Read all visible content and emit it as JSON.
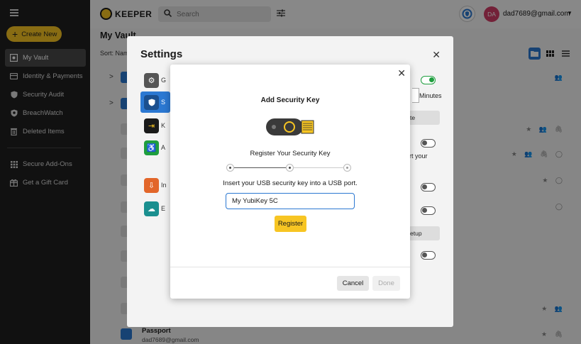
{
  "sidebar": {
    "create_label": "Create New",
    "items": [
      {
        "label": "My Vault",
        "icon": "vault-icon"
      },
      {
        "label": "Identity & Payments",
        "icon": "card-icon"
      },
      {
        "label": "Security Audit",
        "icon": "shield-icon"
      },
      {
        "label": "BreachWatch",
        "icon": "breachwatch-icon"
      },
      {
        "label": "Deleted Items",
        "icon": "trash-icon"
      },
      {
        "label": "Secure Add-Ons",
        "icon": "grid-icon"
      },
      {
        "label": "Get a Gift Card",
        "icon": "gift-icon"
      }
    ]
  },
  "header": {
    "brand": "KEEPER",
    "search_placeholder": "Search",
    "avatar_initials": "DA",
    "user_email": "dad7689@gmail.com"
  },
  "vault": {
    "title": "My Vault",
    "sort_label": "Sort: Name",
    "passport_title": "Passport",
    "passport_email": "dad7689@gmail.com"
  },
  "settings": {
    "title": "Settings",
    "item_letters": [
      "G",
      "S",
      "K",
      "A",
      "In",
      "E"
    ],
    "minutes_label": "Minutes",
    "btn_fragment_1": "te",
    "btn_fragment_2": "etup",
    "text_fragment": "rt your"
  },
  "dialog": {
    "title": "Add Security Key",
    "subtitle": "Register Your Security Key",
    "instruction": "Insert your USB security key into a USB port.",
    "key_name_value": "My YubiKey 5C",
    "register_label": "Register",
    "cancel_label": "Cancel",
    "done_label": "Done",
    "steps_total": 3,
    "current_step": 2
  },
  "colors": {
    "accent": "#f7c523",
    "primary_blue": "#2b78d2",
    "toggle_on": "#1e9e3e",
    "avatar": "#d23d66"
  }
}
